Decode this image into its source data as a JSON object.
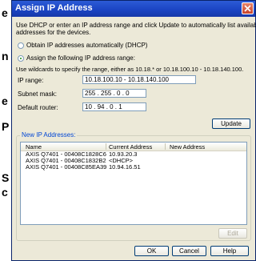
{
  "background": {
    "letters": [
      "e",
      "n",
      "e",
      "P",
      "S",
      "c"
    ]
  },
  "dialog": {
    "title": "Assign IP Address",
    "intro": "Use DHCP or enter an IP address range and click Update to automatically list available addresses for the devices.",
    "intro_line1": "Use DHCP or enter an IP address range and click Update to automatically list available",
    "intro_line2": "addresses for the devices.",
    "option_dhcp": "Obtain IP addresses automatically (DHCP)",
    "option_manual": "Assign the following IP address range:",
    "selected_option": "manual",
    "wildcard_hint": "Use wildcards to specify the range, either as 10.18.* or 10.18.100.10 - 10.18.140.100.",
    "ip_range_label": "IP range:",
    "ip_range_value": "10.18.100.10 - 10.18.140.100",
    "subnet_label": "Subnet mask:",
    "subnet_value": "255 . 255 .  0  .  0",
    "router_label": "Default router:",
    "router_value": "10  .  94  .  0  .  1",
    "update_button": "Update",
    "new_ip_group": "New IP Addresses:",
    "columns": [
      "Name",
      "Current Address",
      "New Address"
    ],
    "rows": [
      {
        "name": "AXIS Q7401 - 00408C1828C6",
        "current": "10.93.20.3",
        "new": ""
      },
      {
        "name": "AXIS Q7401 - 00408C1832B2",
        "current": "<DHCP>",
        "new": ""
      },
      {
        "name": "AXIS Q7401 - 00408C85EA39",
        "current": "10.94.16.51",
        "new": ""
      }
    ],
    "edit_button": "Edit",
    "ok_button": "OK",
    "cancel_button": "Cancel",
    "help_button": "Help",
    "colors": {
      "title_bar": "#1a43c2",
      "window_bg": "#ece9d8",
      "group_label": "#0046d5"
    }
  }
}
